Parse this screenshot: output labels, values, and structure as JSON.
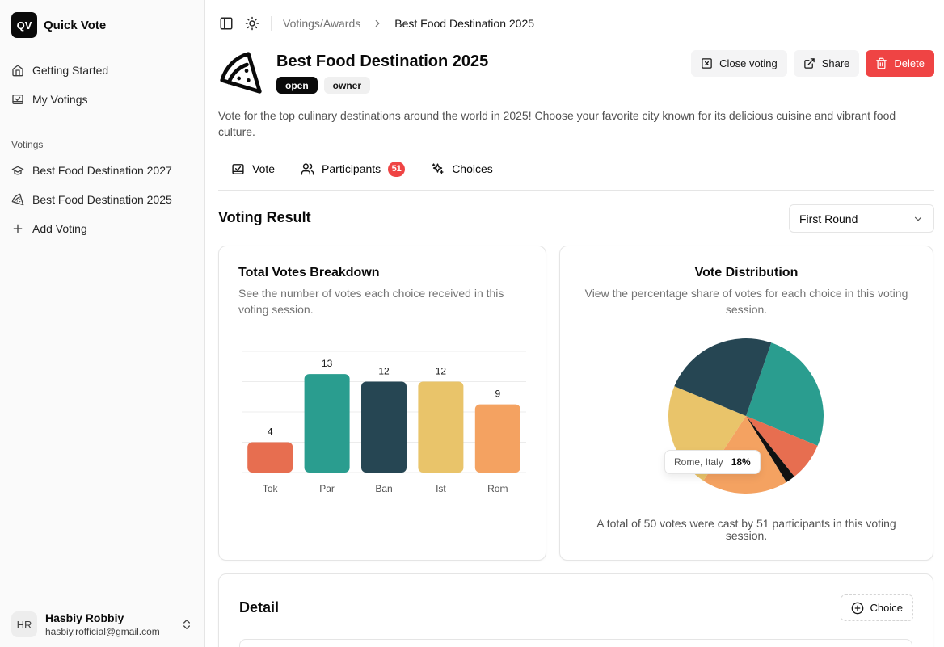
{
  "sidebar": {
    "brand": {
      "logo_text": "QV",
      "name": "Quick Vote"
    },
    "nav": [
      {
        "label": "Getting Started",
        "icon": "home-icon"
      },
      {
        "label": "My Votings",
        "icon": "vote-box-icon"
      }
    ],
    "section_label": "Votings",
    "votings": [
      {
        "label": "Best Food Destination 2027",
        "icon": "graduation-cap-icon"
      },
      {
        "label": "Best Food Destination 2025",
        "icon": "pizza-icon"
      },
      {
        "label": "Add Voting",
        "icon": "plus-icon"
      }
    ],
    "user": {
      "initials": "HR",
      "name": "Hasbiy Robbiy",
      "email": "hasbiy.rofficial@gmail.com"
    }
  },
  "breadcrumb": {
    "parent": "Votings/Awards",
    "current": "Best Food Destination 2025"
  },
  "header": {
    "title": "Best Food Destination 2025",
    "badges": [
      "open",
      "owner"
    ],
    "actions": {
      "close": "Close voting",
      "share": "Share",
      "delete": "Delete"
    }
  },
  "description": "Vote for the top culinary destinations around the world in 2025! Choose your favorite city known for its delicious cuisine and vibrant food culture.",
  "tabs": {
    "vote": "Vote",
    "participants": "Participants",
    "participants_count": "51",
    "choices": "Choices"
  },
  "results": {
    "title": "Voting Result",
    "round_select": "First Round",
    "bar_card": {
      "title": "Total Votes Breakdown",
      "desc": "See the number of votes each choice received in this voting session."
    },
    "pie_card": {
      "title": "Vote Distribution",
      "desc": "View the percentage share of votes for each choice in this voting session.",
      "tooltip_label": "Rome, Italy",
      "tooltip_value": "18%",
      "footer": "A total of 50 votes were cast by 51 participants in this voting session."
    }
  },
  "detail": {
    "title": "Detail",
    "add_choice": "Choice"
  },
  "colors": {
    "tok": "#e76e50",
    "par": "#2a9d8f",
    "ban": "#264653",
    "ist": "#e9c46a",
    "rom": "#f4a261",
    "other": "#111111",
    "accent_red": "#ef4444"
  },
  "chart_data": [
    {
      "type": "bar",
      "title": "Total Votes Breakdown",
      "categories": [
        "Tok",
        "Par",
        "Ban",
        "Ist",
        "Rom"
      ],
      "values": [
        4,
        13,
        12,
        12,
        9
      ],
      "ylim": [
        0,
        16
      ],
      "grid": true
    },
    {
      "type": "pie",
      "title": "Vote Distribution",
      "slices": [
        {
          "key": "par",
          "value": 26
        },
        {
          "key": "tok",
          "value": 8
        },
        {
          "key": "other",
          "value": 2
        },
        {
          "key": "rom",
          "value": 18
        },
        {
          "key": "ist",
          "value": 22
        },
        {
          "key": "ban",
          "value": 24
        }
      ]
    }
  ]
}
